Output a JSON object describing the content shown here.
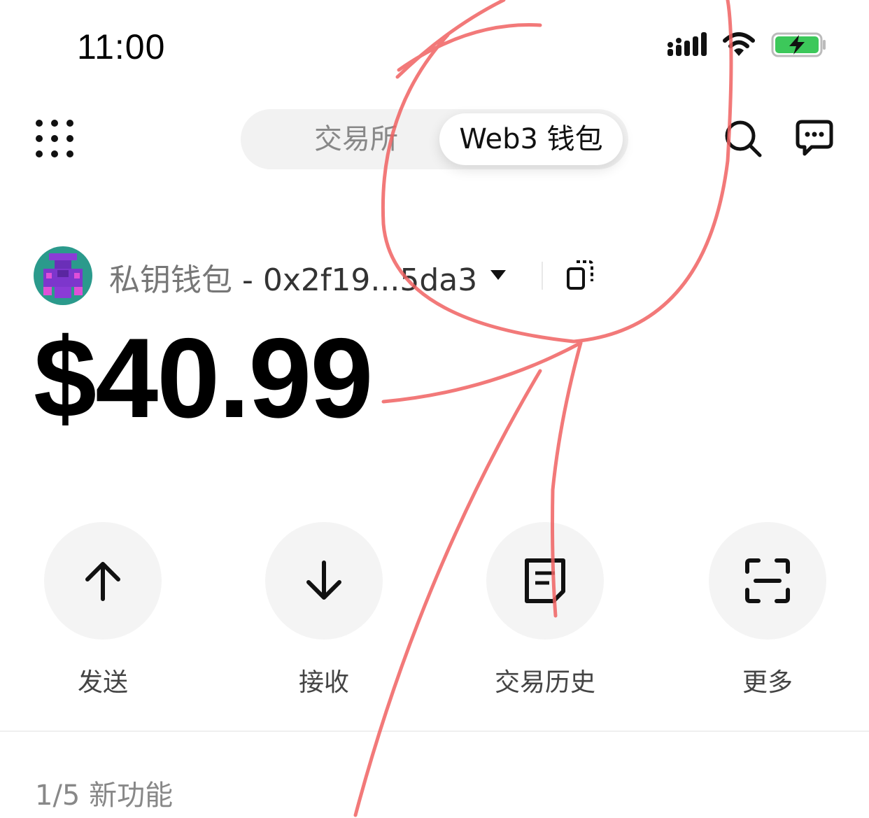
{
  "status_bar": {
    "time": "11:00",
    "icons": [
      "signal-icon",
      "wifi-icon",
      "battery-charging-icon"
    ]
  },
  "header": {
    "menu_icon": "grid-menu-icon",
    "tabs": [
      {
        "label": "交易所",
        "active": false
      },
      {
        "label": "Web3 钱包",
        "active": true
      }
    ],
    "right_icons": [
      "search-icon",
      "chat-icon"
    ]
  },
  "wallet": {
    "name": "私钥钱包",
    "separator": " - ",
    "address": "0x2f19...5da3",
    "balance": "$40.99"
  },
  "actions": [
    {
      "label": "发送",
      "icon": "arrow-up-icon"
    },
    {
      "label": "接收",
      "icon": "arrow-down-icon"
    },
    {
      "label": "交易历史",
      "icon": "document-icon"
    },
    {
      "label": "更多",
      "icon": "scan-icon"
    }
  ],
  "features": {
    "count_label": "1/5 新功能"
  },
  "colors": {
    "accent_text": "#000000",
    "secondary_text": "#888888",
    "circle_bg": "#f4f4f4",
    "battery_green": "#3cc85a",
    "annotation_red": "#f06262"
  }
}
